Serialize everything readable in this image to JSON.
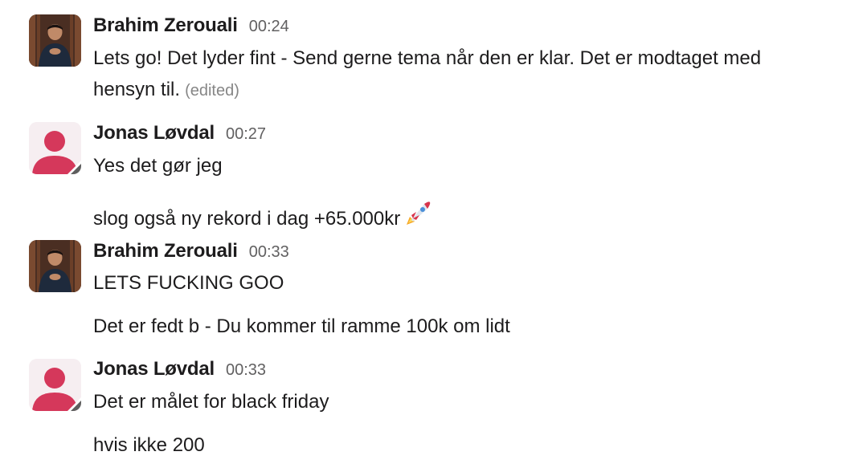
{
  "messages": [
    {
      "sender": "Brahim Zerouali",
      "time": "00:24",
      "avatar": "photo",
      "lines": [
        "Lets go! Det lyder fint - Send gerne tema når den er klar. Det er modtaget med",
        "hensyn til."
      ],
      "edited_label": "(edited)"
    },
    {
      "sender": "Jonas Løvdal",
      "time": "00:27",
      "avatar": "default-user-icon",
      "lines": [
        "Yes det gør jeg",
        "slog også ny rekord i dag +65.000kr"
      ],
      "emoji": "rocket-icon"
    },
    {
      "sender": "Brahim Zerouali",
      "time": "00:33",
      "avatar": "photo",
      "lines": [
        "LETS FUCKING GOO",
        "Det er fedt b - Du kommer til ramme 100k om lidt"
      ]
    },
    {
      "sender": "Jonas Løvdal",
      "time": "00:33",
      "avatar": "default-user-icon",
      "lines": [
        "Det er målet for black friday",
        "hvis ikke 200"
      ]
    }
  ],
  "colors": {
    "text": "#1d1c1d",
    "timestamp": "#616061",
    "edited": "#868686",
    "default_avatar_figure": "#d5385b",
    "default_avatar_bg": "#f6eef1"
  }
}
